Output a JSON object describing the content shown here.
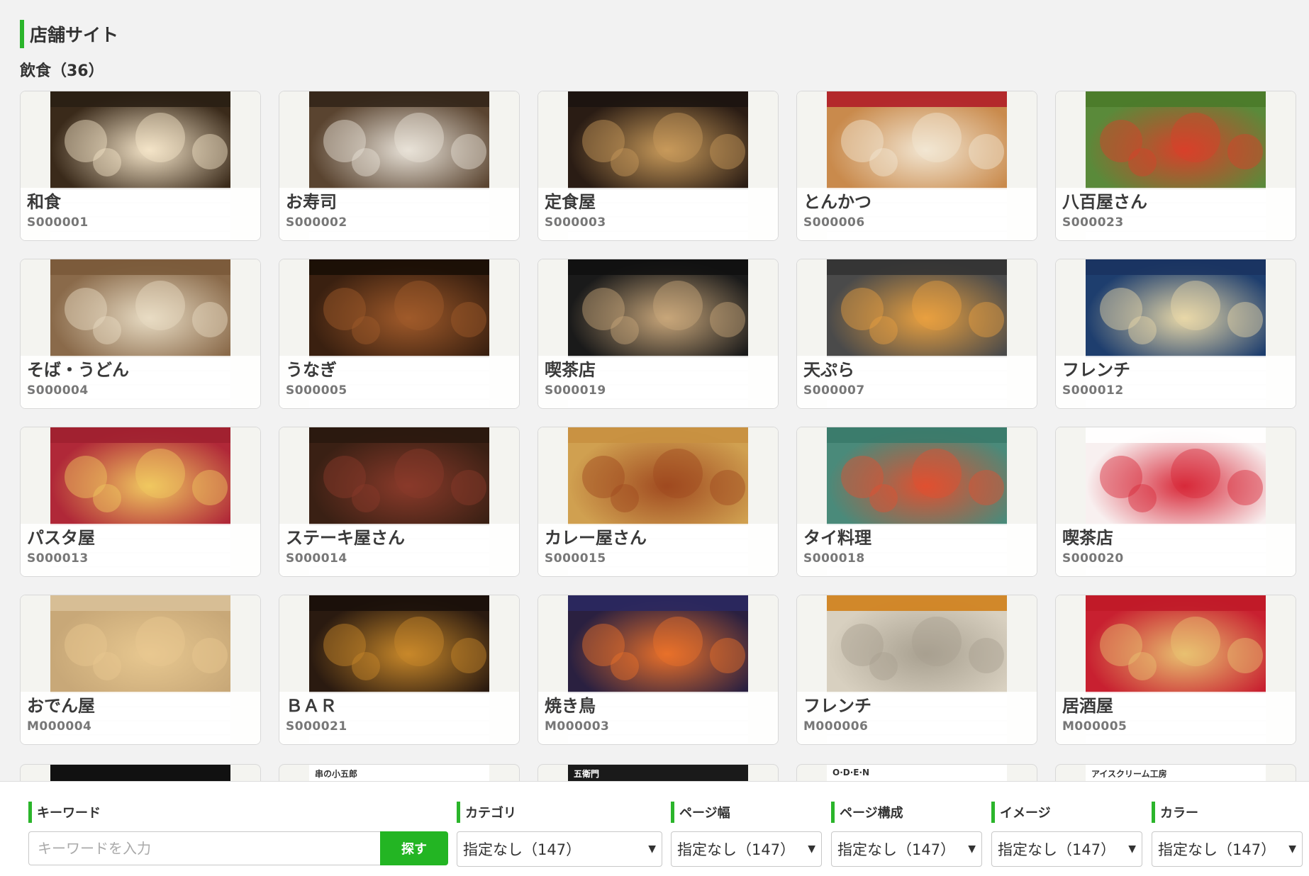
{
  "section_title": "店舗サイト",
  "category_title": "飲食（36）",
  "cards": [
    {
      "name": "和食",
      "code": "S000001",
      "bg": "#3a2a1a",
      "accent": "#f4e4c8",
      "bar": "#2a1f14"
    },
    {
      "name": "お寿司",
      "code": "S000002",
      "bg": "#5a4430",
      "accent": "#e8e2d8",
      "bar": "#33261a"
    },
    {
      "name": "定食屋",
      "code": "S000003",
      "bg": "#2a1c14",
      "accent": "#c89a5a",
      "bar": "#1c1410"
    },
    {
      "name": "とんかつ",
      "code": "S000006",
      "bg": "#c98a4c",
      "accent": "#f2e6d2",
      "bar": "#b01e28"
    },
    {
      "name": "八百屋さん",
      "code": "S000023",
      "bg": "#5a8a3a",
      "accent": "#d8402a",
      "bar": "#4a7a2a"
    },
    {
      "name": "そば・うどん",
      "code": "S000004",
      "bg": "#8a6a4a",
      "accent": "#e8dcc4",
      "bar": "#7a5a3a"
    },
    {
      "name": "うなぎ",
      "code": "S000005",
      "bg": "#3a2010",
      "accent": "#a05a2a",
      "bar": "#1a0e06"
    },
    {
      "name": "喫茶店",
      "code": "S000019",
      "bg": "#1a1a1a",
      "accent": "#c8a67a",
      "bar": "#111111"
    },
    {
      "name": "天ぷら",
      "code": "S000007",
      "bg": "#4a4a4a",
      "accent": "#e8a040",
      "bar": "#333333"
    },
    {
      "name": "フレンチ",
      "code": "S000012",
      "bg": "#1e3e6e",
      "accent": "#e8d8a8",
      "bar": "#1a3360"
    },
    {
      "name": "パスタ屋",
      "code": "S000013",
      "bg": "#b02838",
      "accent": "#f0c860",
      "bar": "#a02030"
    },
    {
      "name": "ステーキ屋さん",
      "code": "S000014",
      "bg": "#3a2014",
      "accent": "#8a3a2a",
      "bar": "#2a180e"
    },
    {
      "name": "カレー屋さん",
      "code": "S000015",
      "bg": "#d0a050",
      "accent": "#a04a20",
      "bar": "#c89040"
    },
    {
      "name": "タイ料理",
      "code": "S000018",
      "bg": "#4a8a7a",
      "accent": "#e05030",
      "bar": "#3a7a6a"
    },
    {
      "name": "喫茶店",
      "code": "S000020",
      "bg": "#f8f0f0",
      "accent": "#d82a3a",
      "bar": "#ffffff"
    },
    {
      "name": "おでん屋",
      "code": "M000004",
      "bg": "#c8a878",
      "accent": "#e8c890",
      "bar": "#d8c098"
    },
    {
      "name": "ＢＡＲ",
      "code": "S000021",
      "bg": "#2a1a10",
      "accent": "#c8882a",
      "bar": "#1a100a"
    },
    {
      "name": "焼き鳥",
      "code": "M000003",
      "bg": "#2a2040",
      "accent": "#e8702a",
      "bar": "#2a2860"
    },
    {
      "name": "フレンチ",
      "code": "M000006",
      "bg": "#d8d0c0",
      "accent": "#a8a090",
      "bar": "#d0801a"
    },
    {
      "name": "居酒屋",
      "code": "M000005",
      "bg": "#c82030",
      "accent": "#e8c070",
      "bar": "#c01a28"
    }
  ],
  "peek_cards": [
    {
      "label": "",
      "bg": "#111111",
      "color": "#ffffff"
    },
    {
      "label": "串の小五郎",
      "bg": "#ffffff",
      "color": "#333333"
    },
    {
      "label": "五衛門",
      "bg": "#1a1a1a",
      "color": "#ffffff"
    },
    {
      "label": "O·D·E·N",
      "bg": "#ffffff",
      "color": "#333333"
    },
    {
      "label": "アイスクリーム工房",
      "bg": "#ffffff",
      "color": "#333333"
    }
  ],
  "filters": {
    "keyword": {
      "label": "キーワード",
      "placeholder": "キーワードを入力",
      "button": "探す"
    },
    "category": {
      "label": "カテゴリ",
      "value": "指定なし（147）"
    },
    "page_width": {
      "label": "ページ幅",
      "value": "指定なし（147）"
    },
    "page_structure": {
      "label": "ページ構成",
      "value": "指定なし（147）"
    },
    "image": {
      "label": "イメージ",
      "value": "指定なし（147）"
    },
    "color": {
      "label": "カラー",
      "value": "指定なし（147）"
    }
  },
  "colors": {
    "accent_green": "#2bb52b",
    "button_green": "#23b523"
  }
}
